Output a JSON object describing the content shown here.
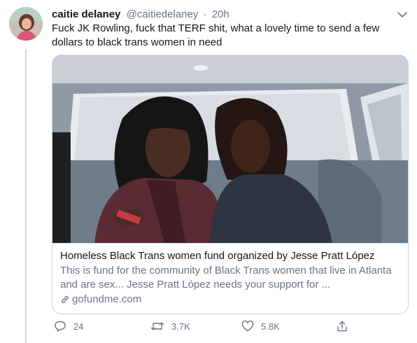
{
  "tweet": {
    "display_name": "caitie delaney",
    "handle": "@caitiedelaney",
    "separator": "·",
    "time": "20h",
    "text": "Fuck JK Rowling, fuck that TERF shit, what a lovely time to send a few dollars to black trans women in need"
  },
  "card": {
    "title": "Homeless Black Trans women fund organized by Jesse Pratt López",
    "description": "This is fund for the community of Black Trans women that live in Atlanta and are sex... Jesse Pratt López needs your support for ...",
    "domain": "gofundme.com"
  },
  "actions": {
    "replies": "24",
    "retweets": "3.7K",
    "likes": "5.8K"
  },
  "icons": {
    "more": "chevron-down-icon",
    "reply": "reply-icon",
    "retweet": "retweet-icon",
    "like": "heart-icon",
    "share": "share-icon",
    "link": "link-icon"
  },
  "colors": {
    "text": "#14171a",
    "secondary": "#657786",
    "border": "#ccd6dd"
  }
}
